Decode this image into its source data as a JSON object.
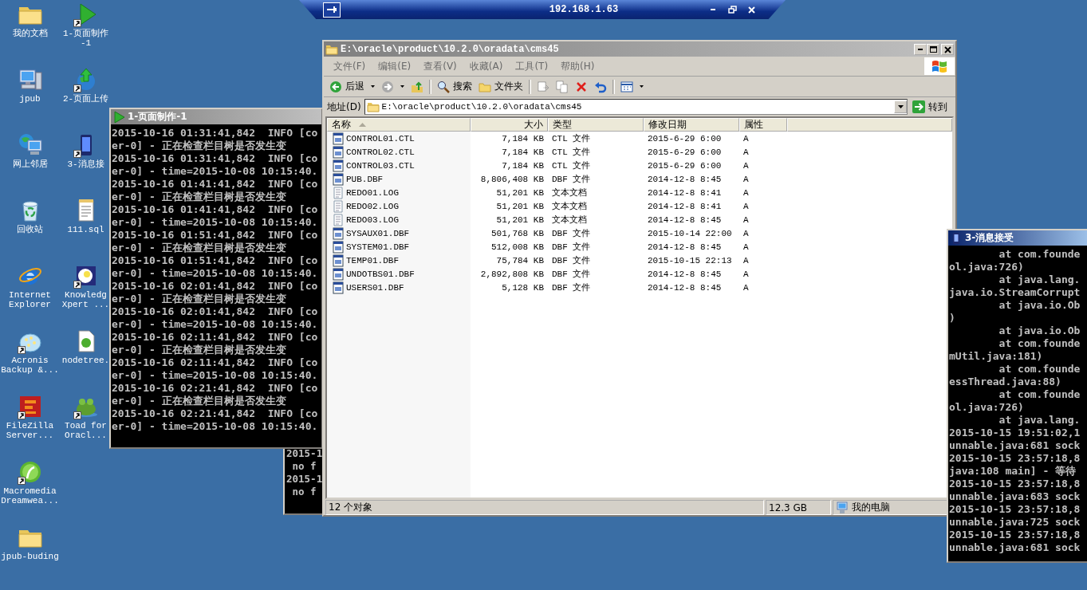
{
  "remote_bar": {
    "title": "192.168.1.63"
  },
  "desktop_icons": [
    {
      "label": "我的文档",
      "kind": "folder",
      "shortcut": false
    },
    {
      "label": "jpub",
      "kind": "computer",
      "shortcut": false
    },
    {
      "label": "网上邻居",
      "kind": "network",
      "shortcut": false
    },
    {
      "label": "回收站",
      "kind": "recycle",
      "shortcut": false
    },
    {
      "label": "Internet\nExplorer",
      "kind": "ie",
      "shortcut": false
    },
    {
      "label": "Acronis\nBackup &...",
      "kind": "acronis",
      "shortcut": true
    },
    {
      "label": "FileZilla\nServer...",
      "kind": "filezilla",
      "shortcut": true
    },
    {
      "label": "Macromedia\nDreamwea...",
      "kind": "dreamweaver",
      "shortcut": true
    },
    {
      "label": "jpub-buding",
      "kind": "folder",
      "shortcut": false
    },
    {
      "label": "1-页面制作\n-1",
      "kind": "play",
      "shortcut": true
    },
    {
      "label": "2-页面上传",
      "kind": "globe",
      "shortcut": true
    },
    {
      "label": "3-消息接",
      "kind": "device",
      "shortcut": true
    },
    {
      "label": "111.sql",
      "kind": "notepad",
      "shortcut": false
    },
    {
      "label": "Knowledg\nXpert ...",
      "kind": "bulb",
      "shortcut": true
    },
    {
      "label": "nodetree.",
      "kind": "page",
      "shortcut": false
    },
    {
      "label": "Toad for\nOracl...",
      "kind": "frog",
      "shortcut": true
    }
  ],
  "windows": [
    {
      "kind": "console",
      "title": "1-页面制作-1",
      "active": false,
      "lines": [
        "2015-10-16 01:31:41,842  INFO [co",
        "er-0] - 正在检查栏目树是否发生变",
        "2015-10-16 01:31:41,842  INFO [co",
        "er-0] - time=2015-10-08 10:15:40.",
        "2015-10-16 01:41:41,842  INFO [co",
        "er-0] - 正在检查栏目树是否发生变",
        "2015-10-16 01:41:41,842  INFO [co",
        "er-0] - time=2015-10-08 10:15:40.",
        "2015-10-16 01:51:41,842  INFO [co",
        "er-0] - 正在检查栏目树是否发生变",
        "2015-10-16 01:51:41,842  INFO [co",
        "er-0] - time=2015-10-08 10:15:40.",
        "2015-10-16 02:01:41,842  INFO [co",
        "er-0] - 正在检查栏目树是否发生变",
        "2015-10-16 02:01:41,842  INFO [co",
        "er-0] - time=2015-10-08 10:15:40.",
        "2015-10-16 02:11:41,842  INFO [co",
        "er-0] - 正在检查栏目树是否发生变",
        "2015-10-16 02:11:41,842  INFO [co",
        "er-0] - time=2015-10-08 10:15:40.",
        "2015-10-16 02:21:41,842  INFO [co",
        "er-0] - 正在检查栏目树是否发生变",
        "2015-10-16 02:21:41,842  INFO [co",
        "er-0] - time=2015-10-08 10:15:40."
      ]
    },
    {
      "kind": "console",
      "lines": [
        "2015-1",
        " no f",
        "2015-1",
        " no f"
      ]
    },
    {
      "kind": "explorer",
      "active": false,
      "title": "E:\\oracle\\product\\10.2.0\\oradata\\cms45",
      "menu": [
        "文件(F)",
        "编辑(E)",
        "查看(V)",
        "收藏(A)",
        "工具(T)",
        "帮助(H)"
      ],
      "toolbar": [
        {
          "kind": "back",
          "label": "后退",
          "disabled": false,
          "menu": true
        },
        {
          "kind": "forward",
          "disabled": true,
          "menu": true
        },
        {
          "kind": "up",
          "disabled": false
        },
        {
          "kind": "separator"
        },
        {
          "kind": "search",
          "label": "搜索",
          "disabled": false
        },
        {
          "kind": "folders",
          "label": "文件夹",
          "disabled": false
        },
        {
          "kind": "separator"
        },
        {
          "kind": "move",
          "disabled": true
        },
        {
          "kind": "copy",
          "disabled": true
        },
        {
          "kind": "delete",
          "disabled": false
        },
        {
          "kind": "undo",
          "disabled": false
        },
        {
          "kind": "separator"
        },
        {
          "kind": "views",
          "disabled": false,
          "menu": true
        }
      ],
      "address": {
        "label": "地址(D)",
        "value": "E:\\oracle\\product\\10.2.0\\oradata\\cms45",
        "go": "转到"
      },
      "columns": [
        {
          "label": "名称",
          "sorted": true
        },
        {
          "label": "大小",
          "sorted": false
        },
        {
          "label": "类型",
          "sorted": false
        },
        {
          "label": "修改日期",
          "sorted": false
        },
        {
          "label": "属性",
          "sorted": false
        }
      ],
      "rows": [
        {
          "kind": "db",
          "name": "CONTROL01.CTL",
          "size": "7,184 KB",
          "type": "CTL 文件",
          "modified": "2015-6-29 6:00",
          "attributes": "A"
        },
        {
          "kind": "db",
          "name": "CONTROL02.CTL",
          "size": "7,184 KB",
          "type": "CTL 文件",
          "modified": "2015-6-29 6:00",
          "attributes": "A"
        },
        {
          "kind": "db",
          "name": "CONTROL03.CTL",
          "size": "7,184 KB",
          "type": "CTL 文件",
          "modified": "2015-6-29 6:00",
          "attributes": "A"
        },
        {
          "kind": "db",
          "name": "PUB.DBF",
          "size": "8,806,408 KB",
          "type": "DBF 文件",
          "modified": "2014-12-8 8:45",
          "attributes": "A"
        },
        {
          "kind": "text",
          "name": "REDO01.LOG",
          "size": "51,201 KB",
          "type": "文本文档",
          "modified": "2014-12-8 8:41",
          "attributes": "A"
        },
        {
          "kind": "text",
          "name": "REDO02.LOG",
          "size": "51,201 KB",
          "type": "文本文档",
          "modified": "2014-12-8 8:41",
          "attributes": "A"
        },
        {
          "kind": "text",
          "name": "REDO03.LOG",
          "size": "51,201 KB",
          "type": "文本文档",
          "modified": "2014-12-8 8:45",
          "attributes": "A"
        },
        {
          "kind": "db",
          "name": "SYSAUX01.DBF",
          "size": "501,768 KB",
          "type": "DBF 文件",
          "modified": "2015-10-14 22:00",
          "attributes": "A"
        },
        {
          "kind": "db",
          "name": "SYSTEM01.DBF",
          "size": "512,008 KB",
          "type": "DBF 文件",
          "modified": "2014-12-8 8:45",
          "attributes": "A"
        },
        {
          "kind": "db",
          "name": "TEMP01.DBF",
          "size": "75,784 KB",
          "type": "DBF 文件",
          "modified": "2015-10-15 22:13",
          "attributes": "A"
        },
        {
          "kind": "db",
          "name": "UNDOTBS01.DBF",
          "size": "2,892,808 KB",
          "type": "DBF 文件",
          "modified": "2014-12-8 8:45",
          "attributes": "A"
        },
        {
          "kind": "db",
          "name": "USERS01.DBF",
          "size": "5,128 KB",
          "type": "DBF 文件",
          "modified": "2014-12-8 8:45",
          "attributes": "A"
        }
      ],
      "status_bar": [
        "12 个对象",
        "12.3 GB",
        "我的电脑"
      ]
    },
    {
      "kind": "console",
      "title": "3-消息接受",
      "active": true,
      "lines": [
        "        at com.founde",
        "ol.java:726)",
        "        at java.lang.",
        "java.io.StreamCorrupt",
        "        at java.io.Ob",
        ")",
        "        at java.io.Ob",
        "        at com.founde",
        "mUtil.java:181)",
        "        at com.founde",
        "essThread.java:88)",
        "        at com.founde",
        "ol.java:726)",
        "        at java.lang.",
        "2015-10-15 19:51:02,1",
        "unnable.java:681 sock",
        "2015-10-15 23:57:18,8",
        "java:108 main] - 等待",
        "2015-10-15 23:57:18,8",
        "unnable.java:683 sock",
        "2015-10-15 23:57:18,8",
        "unnable.java:725 sock",
        "2015-10-15 23:57:18,8",
        "unnable.java:681 sock"
      ]
    }
  ]
}
